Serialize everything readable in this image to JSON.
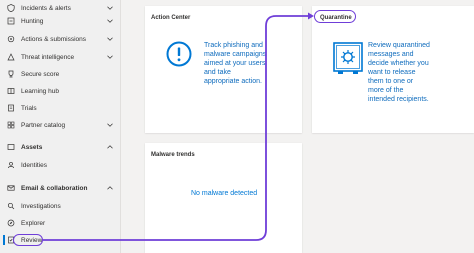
{
  "sidebar": {
    "items": [
      {
        "label": "Incidents & alerts",
        "icon": "alert-shield-icon",
        "chevron": true
      },
      {
        "label": "Hunting",
        "icon": "hunting-icon",
        "chevron": true
      },
      {
        "label": "Actions & submissions",
        "icon": "actions-icon",
        "chevron": true
      },
      {
        "label": "Threat intelligence",
        "icon": "threat-intel-icon",
        "chevron": true
      },
      {
        "label": "Secure score",
        "icon": "trophy-icon",
        "chevron": false
      },
      {
        "label": "Learning hub",
        "icon": "learning-hub-icon",
        "chevron": false
      },
      {
        "label": "Trials",
        "icon": "trials-icon",
        "chevron": false
      },
      {
        "label": "Partner catalog",
        "icon": "partner-catalog-icon",
        "chevron": true
      }
    ],
    "sections": [
      {
        "label": "Assets",
        "icon": "assets-icon",
        "children": [
          {
            "label": "Identities",
            "icon": "identities-icon"
          }
        ]
      },
      {
        "label": "Email & collaboration",
        "icon": "email-icon",
        "children": [
          {
            "label": "Investigations",
            "icon": "investigations-icon"
          },
          {
            "label": "Explorer",
            "icon": "explorer-icon"
          },
          {
            "label": "Review",
            "icon": "review-icon",
            "selected": true
          }
        ]
      }
    ]
  },
  "cards": {
    "action_center": {
      "title": "Action Center",
      "text": "Track phishing and malware campaigns aimed at your users and take appropriate action.",
      "lines": [
        "Track phishing and",
        "malware campaigns",
        "aimed at your users",
        "and take",
        "appropriate action."
      ]
    },
    "quarantine": {
      "title": "Quarantine",
      "lines": [
        "Review quarantined",
        "messages and",
        "decide whether you",
        "want to release",
        "them to one or",
        "more of the",
        "intended recipients."
      ]
    },
    "malware_trends": {
      "title": "Malware trends",
      "empty_text": "No malware detected"
    }
  },
  "colors": {
    "accent": "#0078d4",
    "highlight": "#6f3ed8",
    "link_text": "#0f6cbd"
  }
}
